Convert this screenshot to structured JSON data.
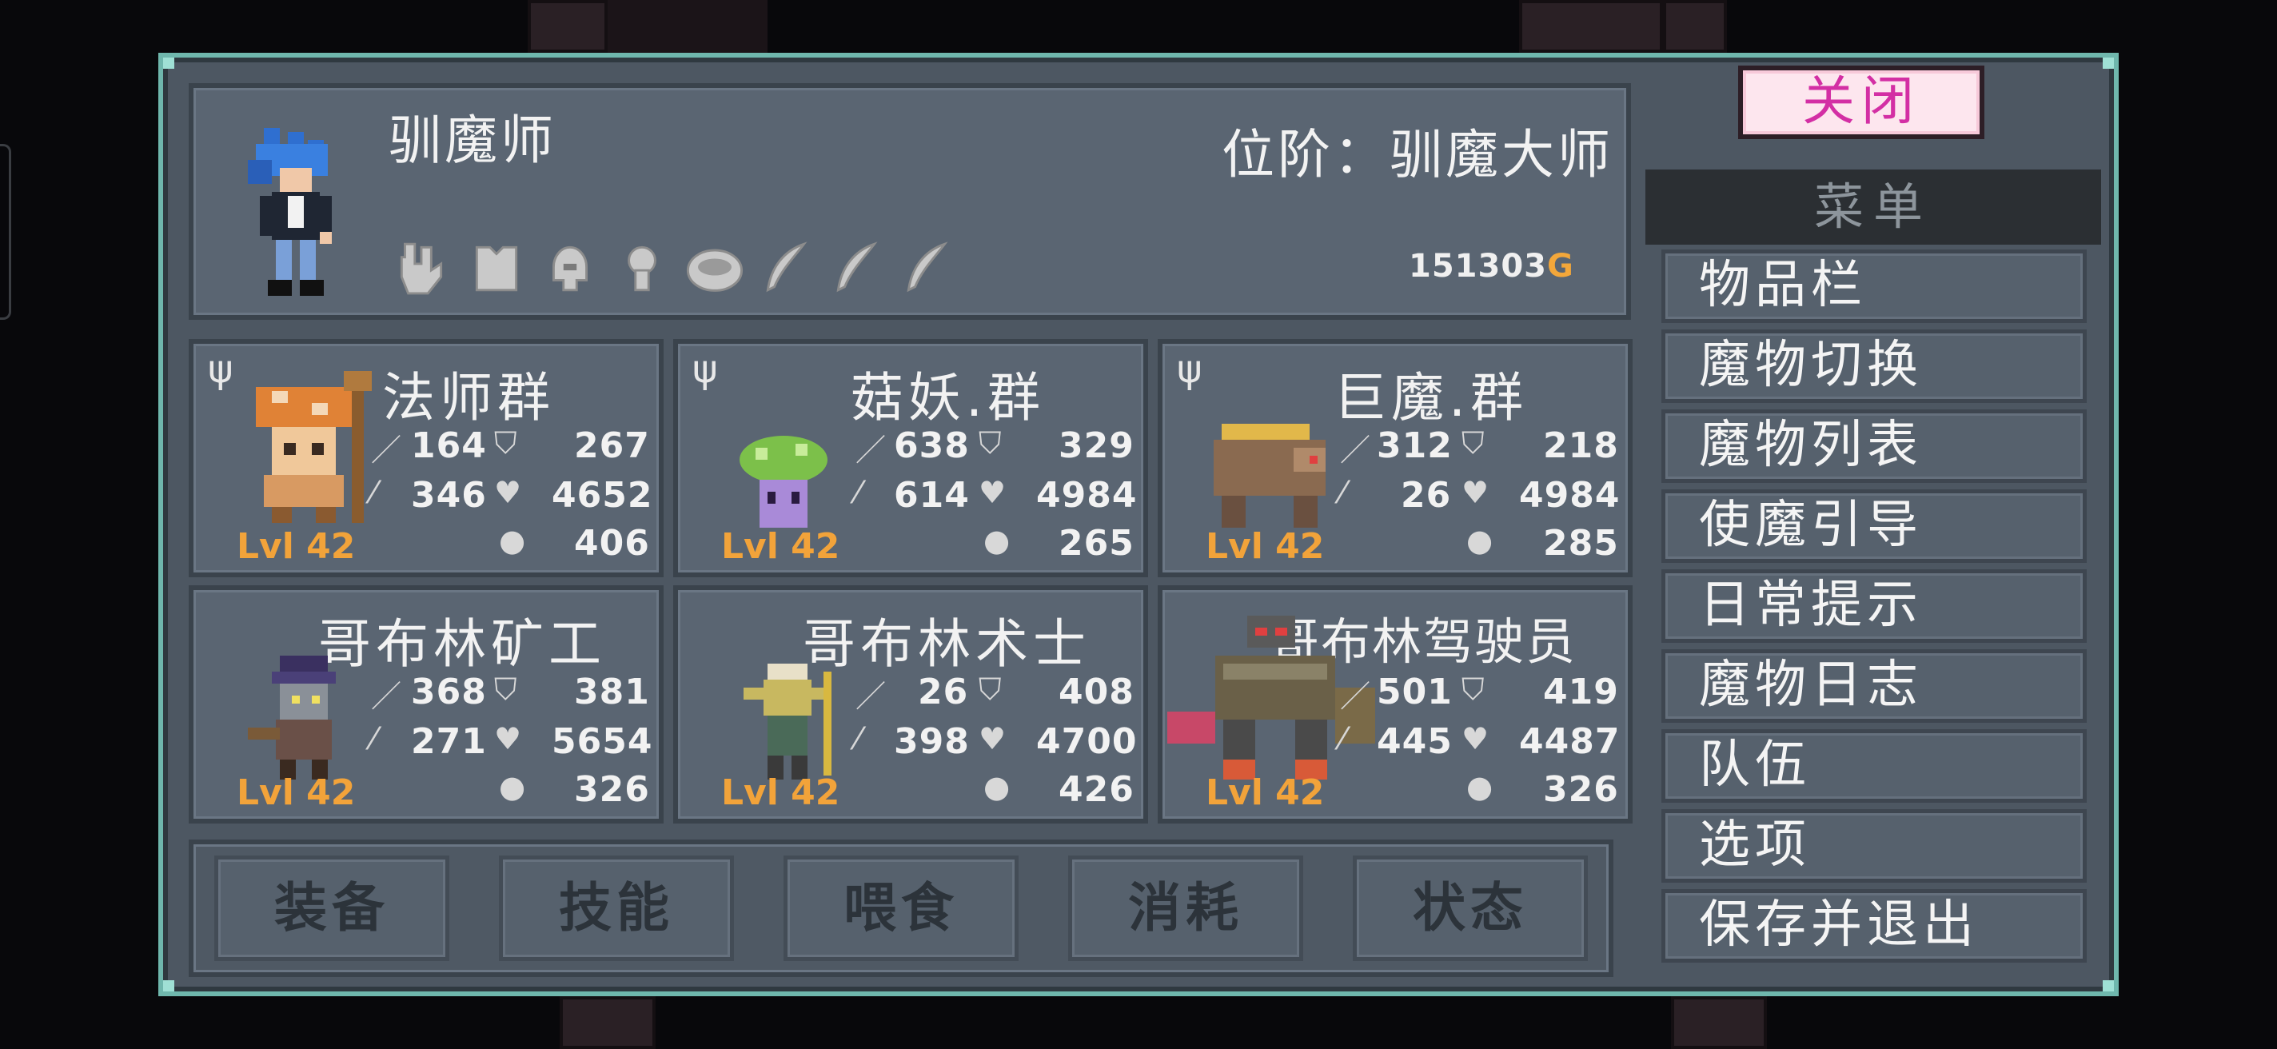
{
  "hero": {
    "name": "驯魔师",
    "rank": "位阶：驯魔大师",
    "gold": "151303",
    "currency_icon": "G",
    "equipment_icons": [
      "gauntlet-icon",
      "armor-icon",
      "helmet-icon",
      "amulet-icon",
      "ring-icon",
      "feather-icon",
      "feather-icon",
      "feather-icon"
    ]
  },
  "monsters": [
    {
      "name": "法师群",
      "attack": "164",
      "defense": "267",
      "magic": "346",
      "hp": "4652",
      "weight": "406",
      "level": "Lvl 42"
    },
    {
      "name": "菇妖.群",
      "attack": "638",
      "defense": "329",
      "magic": "614",
      "hp": "4984",
      "weight": "265",
      "level": "Lvl 42"
    },
    {
      "name": "巨魔.群",
      "attack": "312",
      "defense": "218",
      "magic": "26",
      "hp": "4984",
      "weight": "285",
      "level": "Lvl 42"
    },
    {
      "name": "哥布林矿工",
      "attack": "368",
      "defense": "381",
      "magic": "271",
      "hp": "5654",
      "weight": "326",
      "level": "Lvl 42"
    },
    {
      "name": "哥布林术士",
      "attack": "26",
      "defense": "408",
      "magic": "398",
      "hp": "4700",
      "weight": "426",
      "level": "Lvl 42"
    },
    {
      "name": "哥布林驾驶员",
      "attack": "501",
      "defense": "419",
      "magic": "445",
      "hp": "4487",
      "weight": "326",
      "level": "Lvl 42"
    }
  ],
  "actions": [
    "装备",
    "技能",
    "喂食",
    "消耗",
    "状态"
  ],
  "close_label": "关闭",
  "menu": {
    "header": "菜单",
    "items": [
      "物品栏",
      "魔物切换",
      "魔物列表",
      "使魔引导",
      "日常提示",
      "魔物日志",
      "队伍",
      "选项",
      "保存并退出"
    ]
  },
  "colors": {
    "panel_border": "#6fb7ad",
    "level_text": "#f2a33a",
    "close_text": "#d32fa4",
    "gold_icon": "#f3a73a"
  }
}
